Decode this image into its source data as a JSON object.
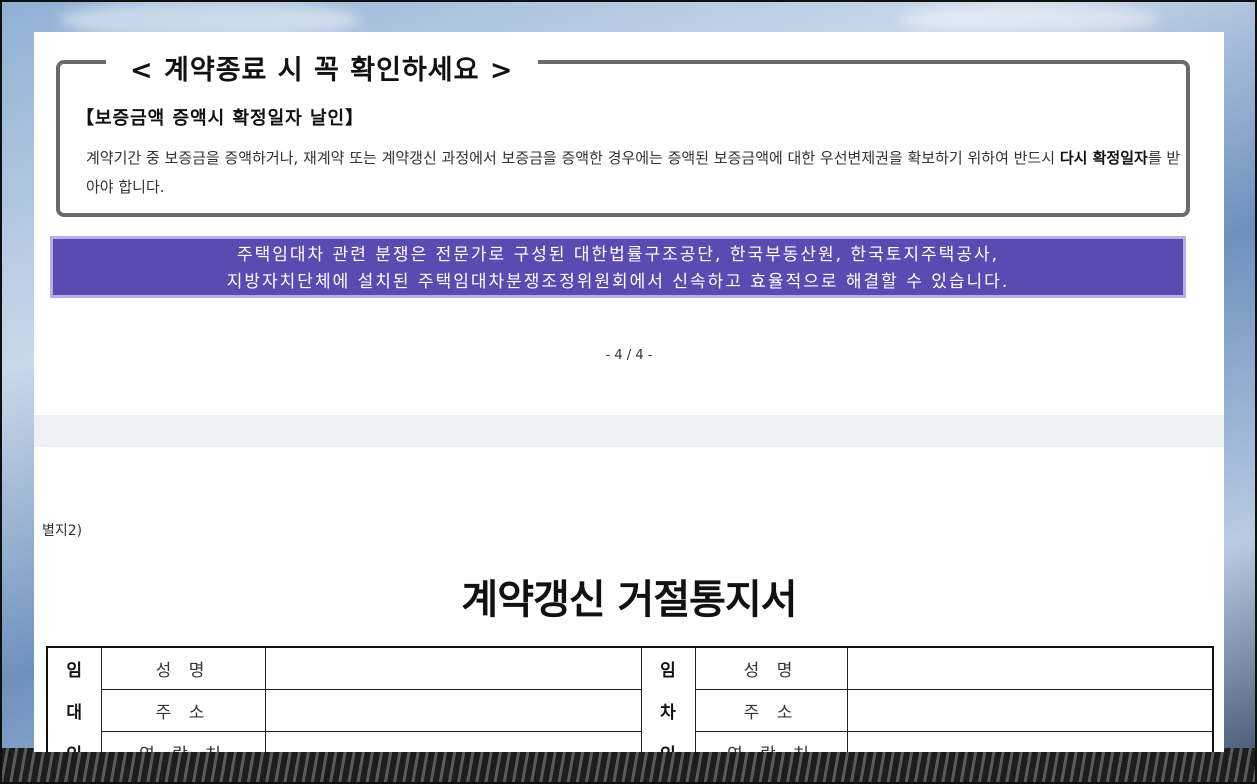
{
  "notice": {
    "title": "< 계약종료 시 꼭 확인하세요 >",
    "subheading": "【보증금액 증액시 확정일자 날인】",
    "body_pre": "계약기간 중 보증금을 증액하거나, 재계약 또는 계약갱신 과정에서 보증금을 증액한 경우에는 증액된 보증금액에 대한 우선변제권을 확보하기 위하여 반드시 ",
    "body_bold": "다시 확정일자",
    "body_post": "를 받아야 합니다."
  },
  "dispute_banner": {
    "line1": "주택임대차 관련 분쟁은 전문가로 구성된 대한법률구조공단, 한국부동산원, 한국토지주택공사,",
    "line2": "지방자치단체에 설치된 주택임대차분쟁조정위원회에서 신속하고 효율적으로 해결할 수 있습니다."
  },
  "page_number": "- 4 / 4 -",
  "annex_label": "별지2)",
  "document_title": "계약갱신 거절통지서",
  "party_table": {
    "landlord_side": [
      "임",
      "대",
      "인"
    ],
    "tenant_side": [
      "임",
      "차",
      "인"
    ],
    "fields": [
      "성 명",
      "주 소",
      "연 락 처"
    ]
  },
  "colors": {
    "banner_bg": "#5a4bb3",
    "notice_border": "#6b6b6b"
  }
}
